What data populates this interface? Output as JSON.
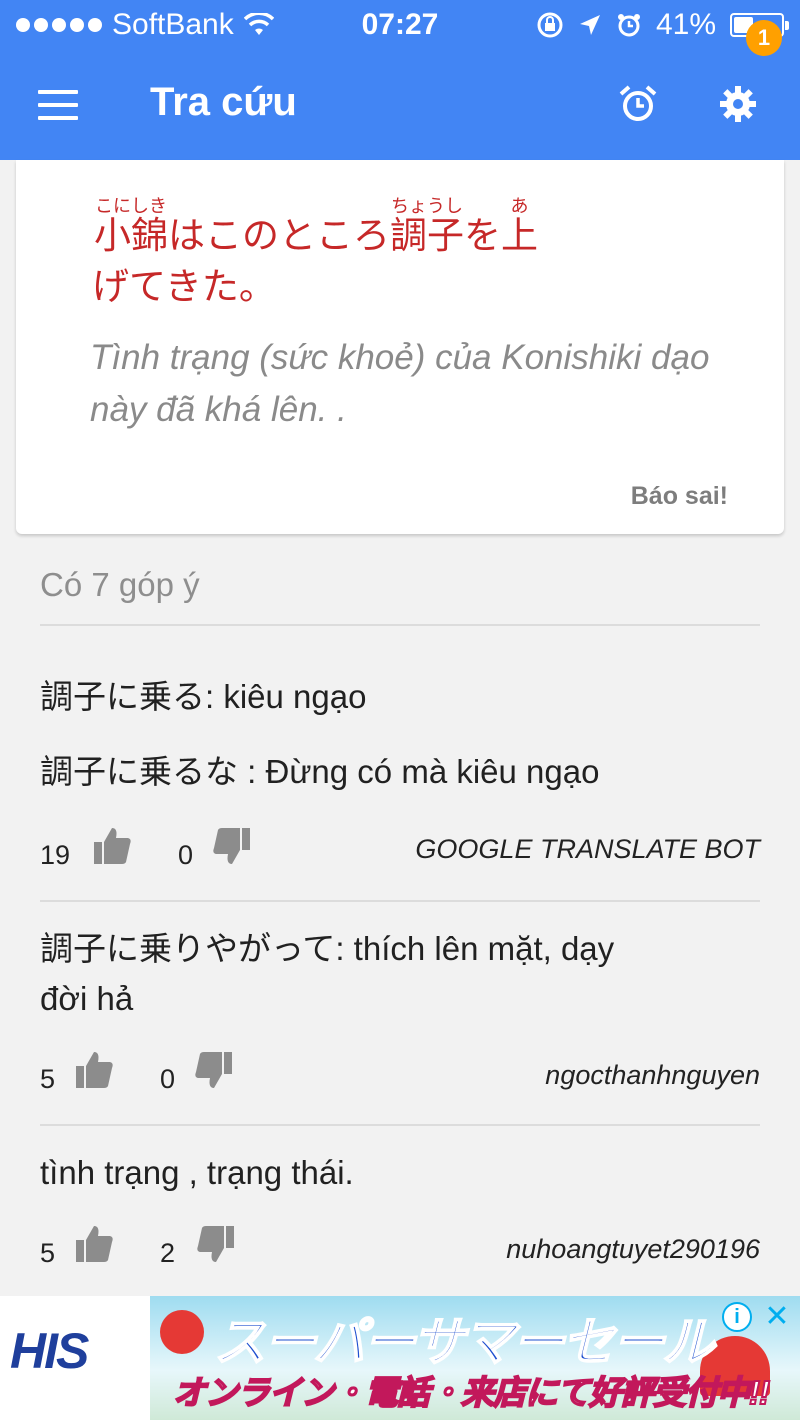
{
  "status_bar": {
    "carrier": "SoftBank",
    "time": "07:27",
    "battery_percent": "41%",
    "battery_level": 0.41
  },
  "header": {
    "title": "Tra cứu",
    "notification_count": "1",
    "color": "#4285f4"
  },
  "example": {
    "line1_segments": [
      {
        "text": "小錦",
        "reading": "こにしき"
      },
      {
        "text": "はこのところ",
        "reading": ""
      },
      {
        "text": "調子",
        "reading": "ちょうし"
      },
      {
        "text": "を",
        "reading": ""
      },
      {
        "text": "上",
        "reading": "あ"
      }
    ],
    "line2": "げてきた。",
    "translation": "Tình trạng (sức khoẻ) của Konishiki dạo này đã khá lên. .",
    "report_label": "Báo sai!",
    "text_color": "#c62828"
  },
  "comments": {
    "count_label": "Có 7 góp ý",
    "items": [
      {
        "lines": [
          "調子に乗る: kiêu ngạo",
          "調子に乗るな : Đừng có mà kiêu ngạo"
        ],
        "likes": "19",
        "dislikes": "0",
        "author": "GOOGLE TRANSLATE BOT"
      },
      {
        "lines": [
          "調子に乗りやがって: thích lên mặt, dạy",
          "đời hả"
        ],
        "likes": "5",
        "dislikes": "0",
        "author": "ngocthanhnguyen"
      },
      {
        "lines": [
          "tình trạng , trạng thái."
        ],
        "likes": "5",
        "dislikes": "2",
        "author": "nuhoangtuyet290196"
      }
    ]
  },
  "ad": {
    "brand": "HIS",
    "headline": "スーパーサマーセール",
    "subline": "オンライン・電話・来店にて好評受付中!!",
    "info_label": "i",
    "close_label": "✕"
  }
}
